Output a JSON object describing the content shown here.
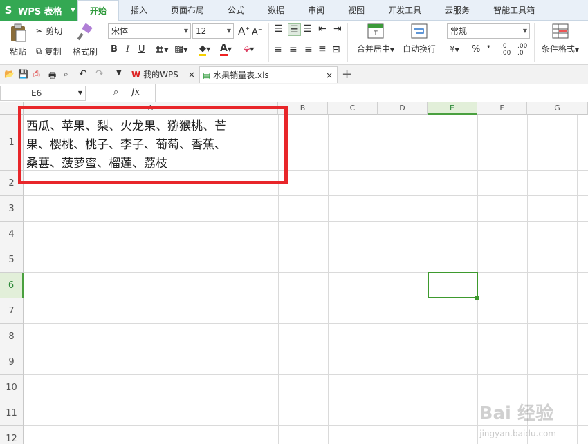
{
  "app": {
    "logo": "S",
    "title": "WPS 表格"
  },
  "menu_tabs": [
    "开始",
    "插入",
    "页面布局",
    "公式",
    "数据",
    "审阅",
    "视图",
    "开发工具",
    "云服务",
    "智能工具箱"
  ],
  "ribbon": {
    "paste": "粘贴",
    "cut": "剪切",
    "copy": "复制",
    "format_painter": "格式刷",
    "font_name": "宋体",
    "font_size": "12",
    "bold": "B",
    "italic": "I",
    "underline": "U",
    "merge_center": "合并居中",
    "wrap_text": "自动换行",
    "number_format": "常规",
    "percent": "%",
    "comma": "❜",
    "inc_decimal": ".0 .00",
    "dec_decimal": ".00 .0",
    "conditional_format": "条件格式"
  },
  "doc_tabs": [
    {
      "label": "我的WPS"
    },
    {
      "label": "水果销量表.xls"
    }
  ],
  "formula_bar": {
    "cell_ref": "E6",
    "fx": "fx",
    "content": ""
  },
  "grid": {
    "columns": [
      "A",
      "B",
      "C",
      "D",
      "E",
      "F",
      "G"
    ],
    "rows": [
      "1",
      "2",
      "3",
      "4",
      "5",
      "6",
      "7",
      "8",
      "9",
      "10",
      "11",
      "12"
    ],
    "selected_cell": "E6",
    "cell_A1_lines": [
      "西瓜、苹果、梨、火龙果、猕猴桃、芒",
      "果、樱桃、桃子、李子、葡萄、香蕉、",
      "桑葚、菠萝蜜、榴莲、荔枝"
    ]
  },
  "watermark": {
    "text": "Bai 经验",
    "url": "jingyan.baidu.com"
  },
  "colors": {
    "accent": "#34a853",
    "highlight": "#e8262a",
    "selection": "#3e9a2e"
  }
}
